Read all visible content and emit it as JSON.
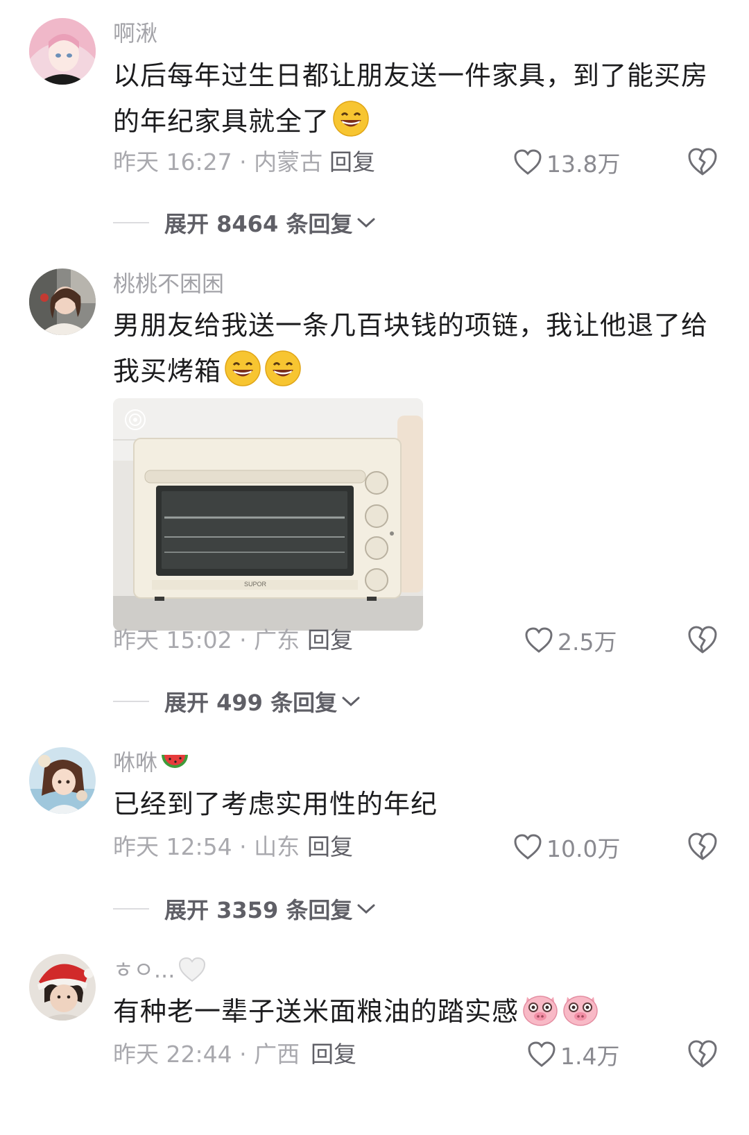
{
  "comments": [
    {
      "username": "啊湫",
      "text": "以后每年过生日都让朋友送一件家具，到了能买房的年纪家具就全了",
      "text_emojis": [
        "grin-emoji"
      ],
      "time": "昨天 16:27",
      "location": "内蒙古",
      "reply_label": "回复",
      "likes": "13.8万",
      "expand_label": "展开 8464 条回复"
    },
    {
      "username": "桃桃不困困",
      "text": "男朋友给我送一条几百块钱的项链，我让他退了给我买烤箱",
      "text_emojis": [
        "grin-emoji",
        "grin-emoji"
      ],
      "image_brand": "SUPOR",
      "time": "昨天 15:02",
      "location": "广东",
      "reply_label": "回复",
      "likes": "2.5万",
      "expand_label": "展开 499 条回复"
    },
    {
      "username": "咻咻",
      "username_emoji": "🍉",
      "text": "已经到了考虑实用性的年纪",
      "time": "昨天 12:54",
      "location": "山东",
      "reply_label": "回复",
      "likes": "10.0万",
      "expand_label": "展开 3359 条回复"
    },
    {
      "username": "ㅎㅇ...",
      "username_emoji": "🤍",
      "text": "有种老一辈子送米面粮油的踏实感",
      "text_emojis": [
        "pig-emoji",
        "pig-emoji"
      ],
      "time": "昨天 22:44",
      "location": "广西",
      "reply_label": "回复",
      "likes": "1.4万"
    }
  ],
  "colors": {
    "text": "#1c1c1e",
    "meta": "#a9a9ae",
    "reply": "#5f5f66",
    "emoji_yellow": "#f7c531"
  }
}
